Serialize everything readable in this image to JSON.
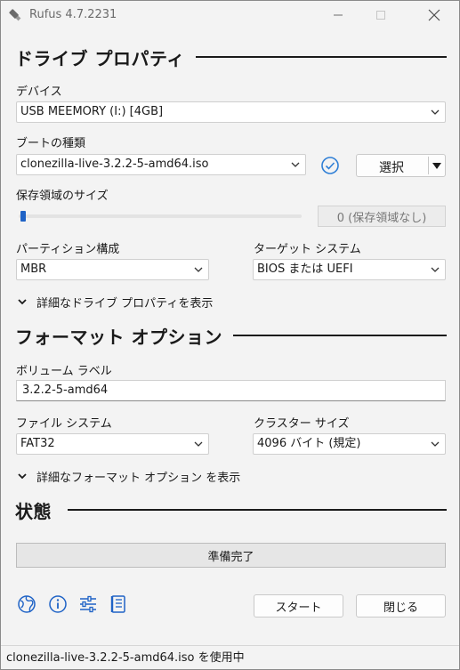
{
  "window": {
    "title": "Rufus 4.7.2231",
    "icon": "usb-drive-icon"
  },
  "drive": {
    "heading": "ドライブ プロパティ",
    "device_label": "デバイス",
    "device_value": "USB MEEMORY (I:) [4GB]",
    "boot_label": "ブートの種類",
    "boot_value": "clonezilla-live-3.2.2-5-amd64.iso",
    "select_button": "選択",
    "persistent_label": "保存領域のサイズ",
    "persistent_value": "0 (保存領域なし)",
    "persistent_level": 0,
    "partition_label": "パーティション構成",
    "partition_value": "MBR",
    "target_label": "ターゲット システム",
    "target_value": "BIOS または UEFI",
    "advanced_toggle": "詳細なドライブ プロパティを表示"
  },
  "format": {
    "heading": "フォーマット オプション",
    "volume_label": "ボリューム ラベル",
    "volume_value": "3.2.2-5-amd64",
    "fs_label": "ファイル システム",
    "fs_value": "FAT32",
    "cluster_label": "クラスター サイズ",
    "cluster_value": "4096 バイト (規定)",
    "advanced_toggle": "詳細なフォーマット オプション を表示"
  },
  "status": {
    "heading": "状態",
    "text": "準備完了"
  },
  "actions": {
    "start": "スタート",
    "close": "閉じる"
  },
  "toolbar_icons": [
    "globe-icon",
    "info-icon",
    "settings-sliders-icon",
    "log-icon"
  ],
  "footer": {
    "text": "clonezilla-live-3.2.2-5-amd64.iso を使用中"
  },
  "colors": {
    "accent": "#1f63c6",
    "check": "#2f7fd6",
    "background": "#f3f3f3"
  }
}
